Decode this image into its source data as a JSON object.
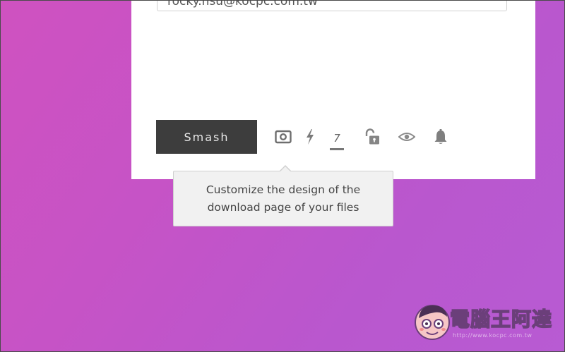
{
  "form": {
    "email_value": "rocky.hsu@kocpc.com.tw"
  },
  "toolbar": {
    "smash_label": "Smash",
    "days_value": "7",
    "icons": [
      "customize-icon",
      "lightning-icon",
      "days-counter",
      "unlock-icon",
      "eye-icon",
      "bell-icon"
    ]
  },
  "tooltip": {
    "text": "Customize the design of the download page of your files"
  },
  "watermark": {
    "text": "電腦王阿達",
    "url": "http://www.kocpc.com.tw"
  },
  "colors": {
    "background_start": "#cf52c0",
    "background_end": "#b85bd3",
    "button": "#3d3d3d",
    "icon": "#777777"
  }
}
